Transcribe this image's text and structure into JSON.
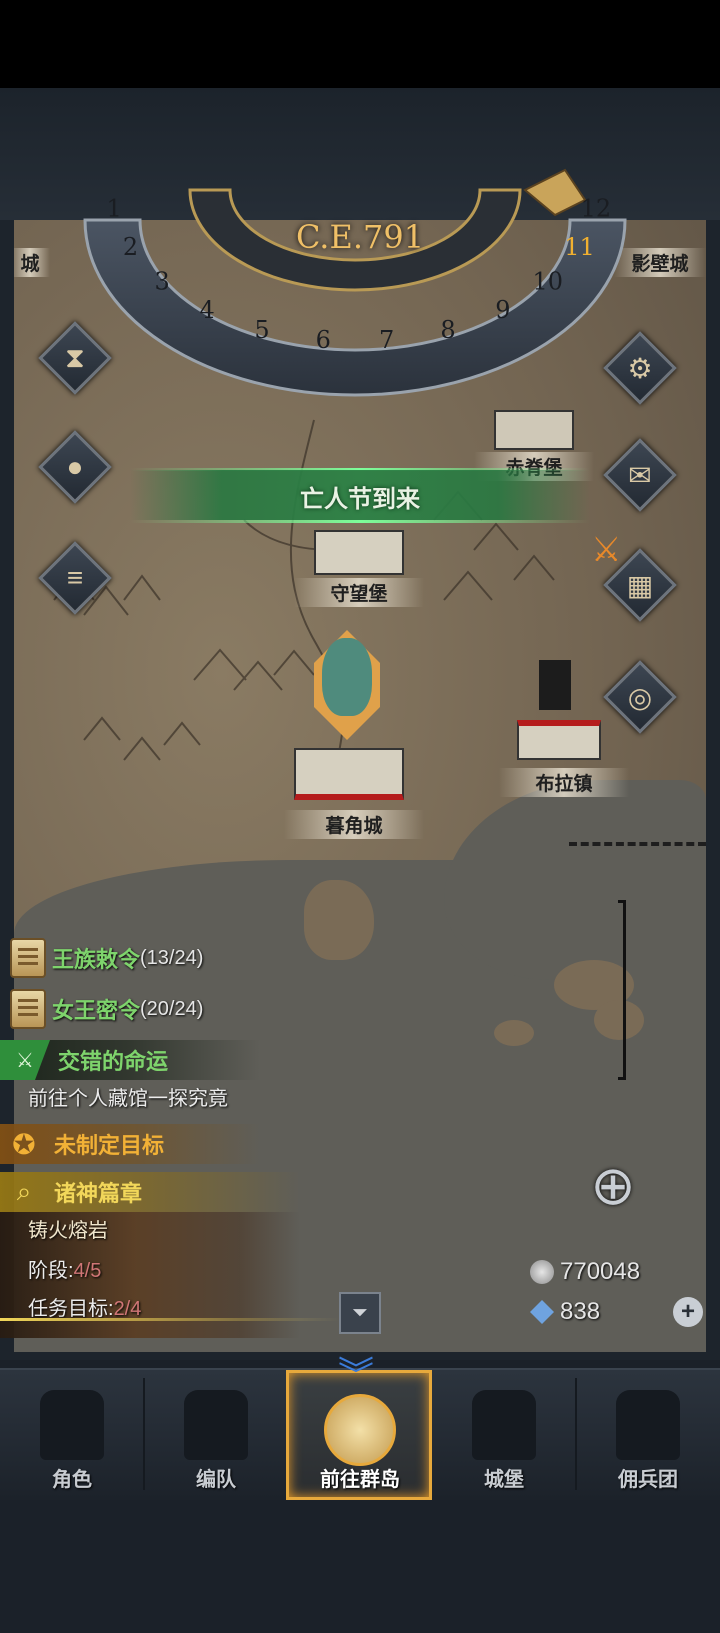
{
  "era": "C.E.791",
  "dial": {
    "months": [
      "1",
      "2",
      "3",
      "4",
      "5",
      "6",
      "7",
      "8",
      "9",
      "10",
      "11",
      "12"
    ],
    "current_month": "11"
  },
  "event_banner": "亡人节到来",
  "towns": {
    "red_spine": "赤脊堡",
    "watch_fort": "守望堡",
    "dusk_horn": "暮角城",
    "bula": "布拉镇",
    "shadow_wall": "影壁城",
    "edge_city": "城"
  },
  "quests": [
    {
      "label": "王族敕令",
      "count": "(13/24)"
    },
    {
      "label": "女王密令",
      "count": "(20/24)"
    }
  ],
  "tracked": [
    {
      "title": "交错的命运",
      "desc": "前往个人藏馆一探究竟",
      "color": "#7ed46c"
    },
    {
      "title": "未制定目标",
      "color": "#f2b136"
    },
    {
      "title": "诸神篇章",
      "color": "#f2d75a"
    }
  ],
  "task": {
    "name": "铸火熔岩",
    "stage_label": "阶段:",
    "stage_value": "4/5",
    "goal_label": "任务目标:",
    "goal_value": "2/4"
  },
  "currency": {
    "silver": "770048",
    "crystal": "838"
  },
  "nav": [
    {
      "label": "角色"
    },
    {
      "label": "编队"
    },
    {
      "label": "前往群岛"
    },
    {
      "label": "城堡"
    },
    {
      "label": "佣兵团"
    }
  ],
  "colors": {
    "accent_gold": "#e7a93c",
    "quest_green": "#7ed46c",
    "stage_red": "#d07676"
  },
  "icons": [
    "hourglass-icon",
    "pouch-icon",
    "scroll-icon",
    "gear-icon",
    "mail-icon",
    "swords-icon",
    "building-icon",
    "coin-icon",
    "locate-icon",
    "collapse-icon",
    "plus-icon"
  ]
}
